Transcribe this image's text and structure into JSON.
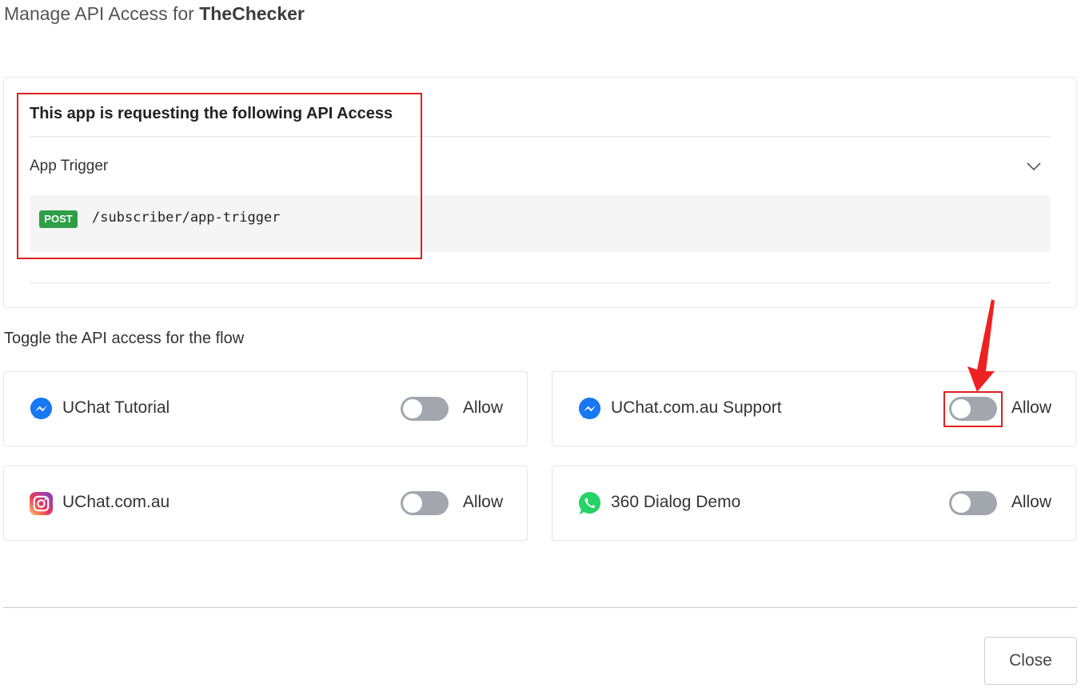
{
  "dialog": {
    "title_prefix": "Manage API Access for ",
    "app_name": "TheChecker"
  },
  "api_request": {
    "heading": "This app is requesting the following API Access",
    "trigger_label": "App Trigger",
    "method": "POST",
    "path": "/subscriber/app-trigger",
    "method_color": "#2e9e47"
  },
  "flows": {
    "heading": "Toggle the API access for the flow",
    "items": [
      {
        "name": "UChat Tutorial",
        "channel_icon": "messenger-icon",
        "allow_label": "Allow",
        "enabled": false
      },
      {
        "name": "UChat.com.au Support",
        "channel_icon": "messenger-icon",
        "allow_label": "Allow",
        "enabled": false
      },
      {
        "name": "UChat.com.au",
        "channel_icon": "instagram-icon",
        "allow_label": "Allow",
        "enabled": false
      },
      {
        "name": "360 Dialog Demo",
        "channel_icon": "whatsapp-icon",
        "allow_label": "Allow",
        "enabled": false
      }
    ]
  },
  "footer": {
    "close_label": "Close"
  },
  "annotations": {
    "highlight_color": "#e02020"
  }
}
